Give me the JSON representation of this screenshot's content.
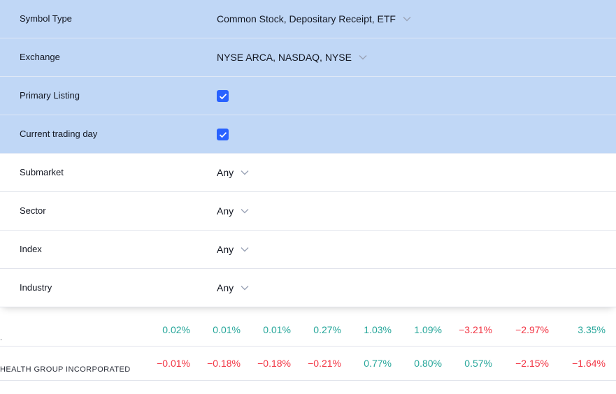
{
  "filters": [
    {
      "label": "Symbol Type",
      "value": "Common Stock, Depositary Receipt, ETF",
      "kind": "select",
      "active": true
    },
    {
      "label": "Exchange",
      "value": "NYSE ARCA, NASDAQ, NYSE",
      "kind": "select",
      "active": true
    },
    {
      "label": "Primary Listing",
      "value": "",
      "kind": "checkbox",
      "checked": true,
      "active": true
    },
    {
      "label": "Current trading day",
      "value": "",
      "kind": "checkbox",
      "checked": true,
      "active": true
    },
    {
      "label": "Submarket",
      "value": "Any",
      "kind": "select",
      "active": false
    },
    {
      "label": "Sector",
      "value": "Any",
      "kind": "select",
      "active": false
    },
    {
      "label": "Index",
      "value": "Any",
      "kind": "select",
      "active": false
    },
    {
      "label": "Industry",
      "value": "Any",
      "kind": "select",
      "active": false
    }
  ],
  "table": {
    "rows": [
      {
        "symbol": ".",
        "values": [
          {
            "text": "0.02%",
            "dir": "pos"
          },
          {
            "text": "0.01%",
            "dir": "pos"
          },
          {
            "text": "0.01%",
            "dir": "pos"
          },
          {
            "text": "0.27%",
            "dir": "pos"
          },
          {
            "text": "1.03%",
            "dir": "pos"
          },
          {
            "text": "1.09%",
            "dir": "pos"
          },
          {
            "text": "−3.21%",
            "dir": "neg"
          },
          {
            "text": "−2.97%",
            "dir": "neg"
          },
          {
            "text": "3.35%",
            "dir": "pos"
          }
        ]
      },
      {
        "symbol": "HEALTH GROUP INCORPORATED",
        "values": [
          {
            "text": "−0.01%",
            "dir": "neg"
          },
          {
            "text": "−0.18%",
            "dir": "neg"
          },
          {
            "text": "−0.18%",
            "dir": "neg"
          },
          {
            "text": "−0.21%",
            "dir": "neg"
          },
          {
            "text": "0.77%",
            "dir": "pos"
          },
          {
            "text": "0.80%",
            "dir": "pos"
          },
          {
            "text": "0.57%",
            "dir": "pos"
          },
          {
            "text": "−2.15%",
            "dir": "neg"
          },
          {
            "text": "−1.64%",
            "dir": "neg"
          }
        ]
      }
    ]
  },
  "colors": {
    "active_row": "#c0d7f6",
    "checkbox": "#2962ff",
    "positive": "#26a69a",
    "negative": "#f23645"
  },
  "icons": {
    "dropdown": "chevron-down-icon",
    "checked": "checkmark-icon"
  }
}
